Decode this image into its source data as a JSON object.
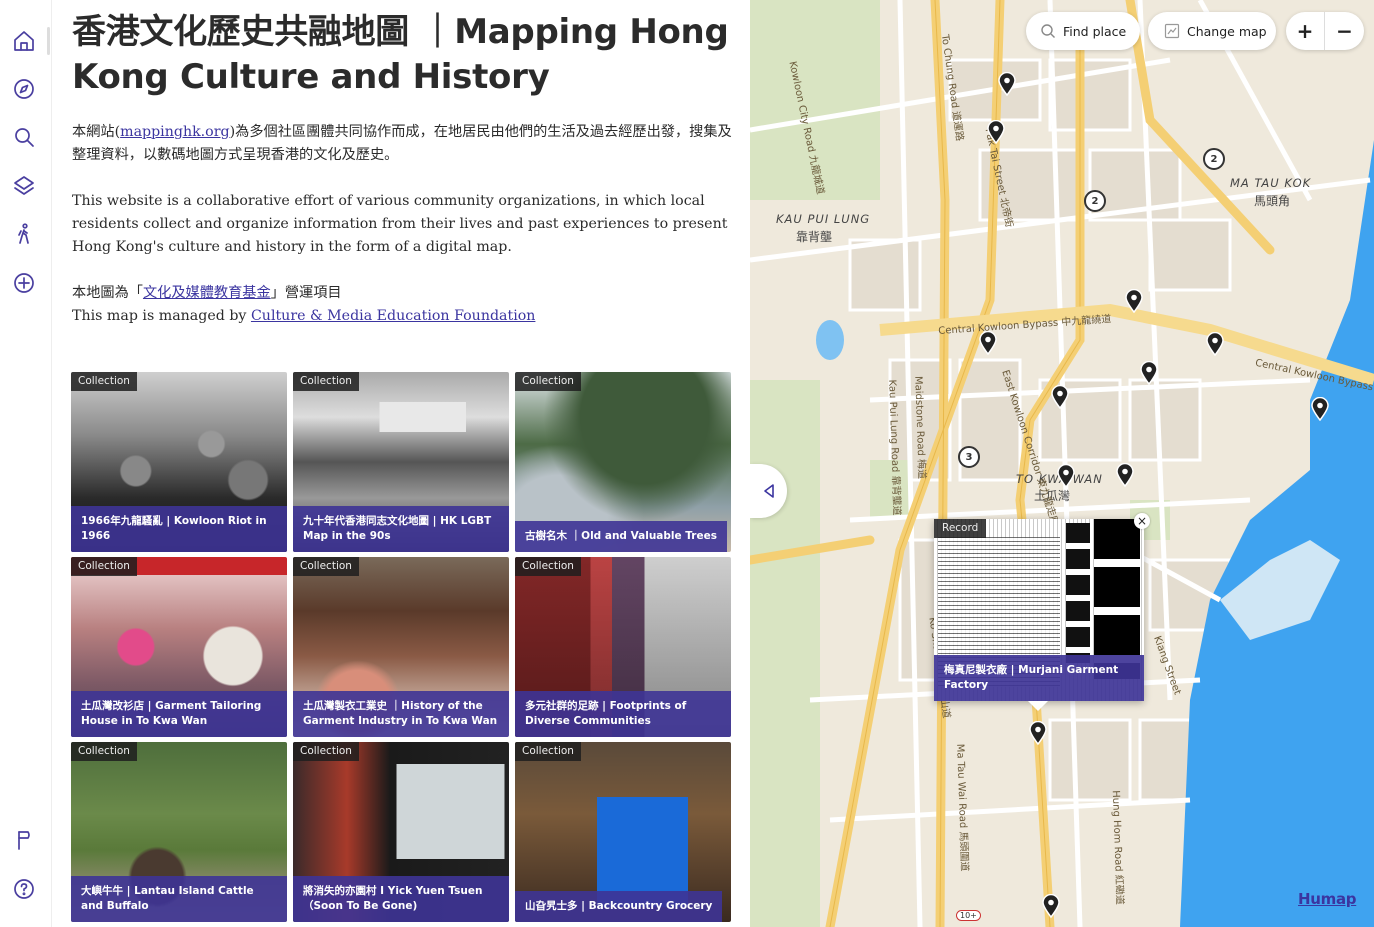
{
  "sidebar": {
    "items": [
      {
        "icon": "home-icon",
        "label": "Home"
      },
      {
        "icon": "compass-icon",
        "label": "Explore"
      },
      {
        "icon": "search-icon",
        "label": "Search"
      },
      {
        "icon": "layers-icon",
        "label": "Layers"
      },
      {
        "icon": "walking-icon",
        "label": "Tours"
      },
      {
        "icon": "plus-circle-icon",
        "label": "Add"
      }
    ],
    "bottom": [
      {
        "icon": "flag-icon",
        "label": "Report"
      },
      {
        "icon": "help-icon",
        "label": "Help"
      }
    ]
  },
  "panel": {
    "title": "香港文化歷史共融地圖 ｜Mapping Hong Kong Culture and History",
    "intro_zh_before": "本網站(",
    "intro_zh_link": "mappinghk.org",
    "intro_zh_after": ")為多個社區團體共同協作而成，在地居民由他們的生活及過去經歷出發，搜集及整理資料，以數碼地圖方式呈現香港的文化及歷史。",
    "intro_en": "This website is a collaborative effort of various community organizations, in which local residents collect and organize information from their lives and past experiences to present Hong Kong's culture and history in the form of a digital map.",
    "managed_zh_before": "本地圖為「",
    "managed_zh_link": "文化及媒體教育基金",
    "managed_zh_after": "」營運項目",
    "managed_en_before": "This map is managed by ",
    "managed_en_link": "Culture & Media Education Foundation"
  },
  "collections": [
    {
      "tag": "Collection",
      "title": "1966年九龍騷亂 | Kowloon Riot in 1966"
    },
    {
      "tag": "Collection",
      "title": "九十年代香港同志文化地圖 | HK LGBT Map in the 90s"
    },
    {
      "tag": "Collection",
      "title": "古樹名木 ｜Old and Valuable Trees"
    },
    {
      "tag": "Collection",
      "title": "土瓜灣改衫店 | Garment Tailoring House in To Kwa Wan"
    },
    {
      "tag": "Collection",
      "title": "土瓜灣製衣工業史 ｜History of the Garment Industry in To Kwa Wan"
    },
    {
      "tag": "Collection",
      "title": "多元社群的足跡 | Footprints of Diverse Communities"
    },
    {
      "tag": "Collection",
      "title": "大嶼牛牛 | Lantau Island Cattle and Buffalo"
    },
    {
      "tag": "Collection",
      "title": "將消失的亦園村 I Yick Yuen Tsuen （Soon To Be Gone)"
    },
    {
      "tag": "Collection",
      "title": "山旮旯士多 | Backcountry Grocery"
    }
  ],
  "map": {
    "find_place": "Find place",
    "change_map": "Change map",
    "zoom_in": "+",
    "zoom_out": "−",
    "popup": {
      "tag": "Record",
      "close": "×",
      "title": "梅真尼製衣廠 | Murjani Garment Factory"
    },
    "brand": "Humap",
    "districts": {
      "ma_tau_kok_en": "MA TAU KOK",
      "ma_tau_kok_zh": "馬頭角",
      "kau_pui_lung_en": "KAU PUI LUNG",
      "kau_pui_lung_zh": "靠背壟",
      "to_kwa_wan_en": "TO KWA WAN",
      "to_kwa_wan_zh": "土瓜灣"
    },
    "roads": {
      "bypass": "Central Kowloon Bypass 中九龍繞道",
      "bypass_e": "Central Kowloon Bypass",
      "to_chung": "To Chung Road 道運路",
      "pak_tai": "Pak Tai Street 北帝街",
      "ma_tau_wai": "Ma Tau Wai Road 馬頭圍道",
      "kowloon_city": "Kowloon City Road 九龍城道",
      "east_kowloon": "East Kowloon Corridor 東九龍走廊",
      "kau_pui_lung": "Kau Pui Lung Road 靠背壟道",
      "maidstone": "Maidstone Road 梅道",
      "ko_shan": "Ko Shan Road 高山道",
      "hung_hom": "Hung Hom Road 紅磡道",
      "kiang_shan": "Kiang Street",
      "route_shield": "10+"
    },
    "clusters": [
      "2",
      "2",
      "3"
    ],
    "colors": {
      "water": "#3fa3f0",
      "trunk": "#f4cf74",
      "accent": "#3b35a0"
    }
  }
}
